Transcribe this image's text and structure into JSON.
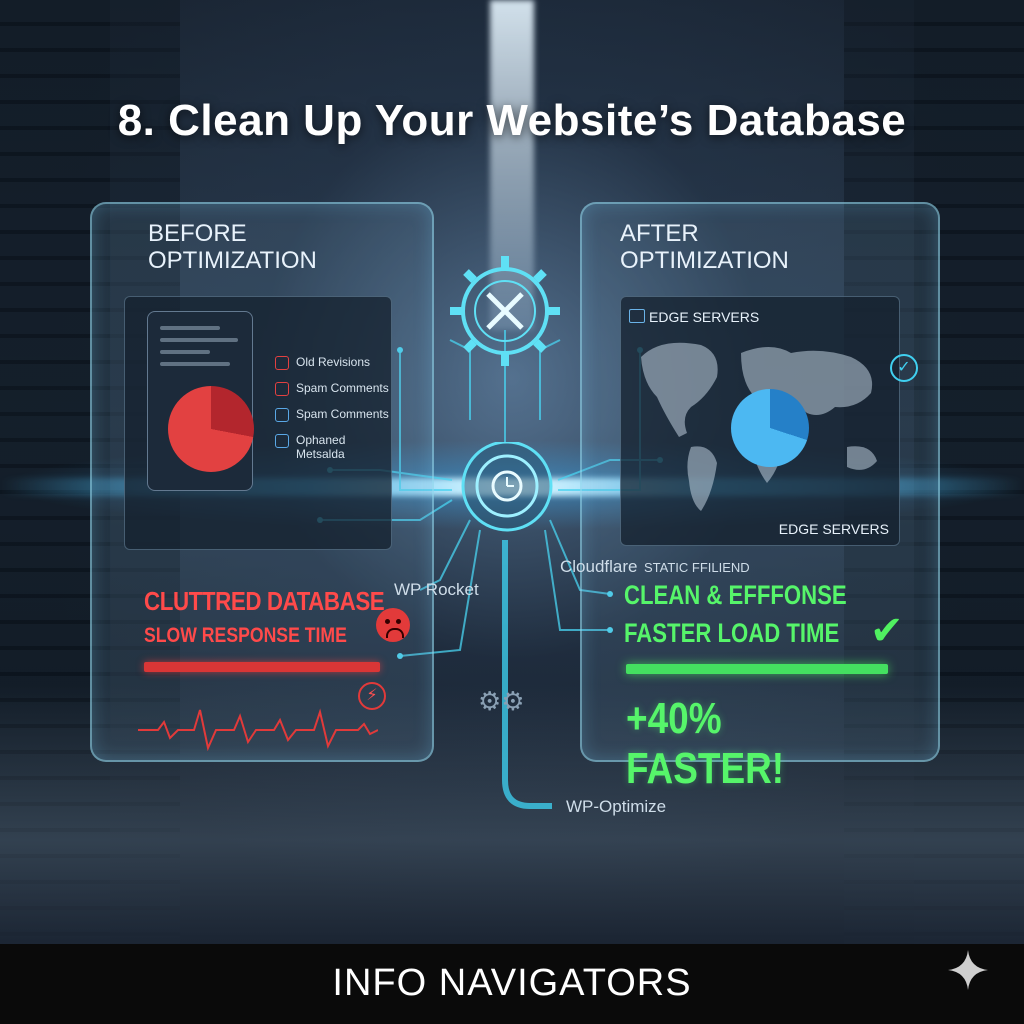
{
  "title": "8. Clean Up Your Website’s Database",
  "before": {
    "heading": "BEFORE\nOPTIMIZATION",
    "items": [
      {
        "label": "Old Revisions",
        "icon": "trash-icon"
      },
      {
        "label": "Spam Comments",
        "icon": "comment-icon"
      },
      {
        "label": "Spam Comments",
        "icon": "comment-icon"
      },
      {
        "label": "Ophaned\nMetsalda",
        "icon": "tag-icon"
      }
    ],
    "status_main": "CLUTTRED DATABASE",
    "status_sub": "SLOW RESPONSE TIME",
    "accent": "#e23a3a"
  },
  "after": {
    "heading": "AFTER\nOPTIMIZATION",
    "map_label_top": "EDGE SERVERS",
    "map_label_bottom": "EDGE SERVERS",
    "status_main": "CLEAN & EFFFONSE",
    "status_sub": "FASTER LOAD TIME",
    "improvement": "+40% FASTER!",
    "accent": "#56f56a"
  },
  "tools": {
    "wp_rocket": "WP Rocket",
    "cloudflare": "Cloudflare",
    "static": "STATIC FFILIEND",
    "wp_optimize": "WP-Optimize"
  },
  "footer": {
    "brand": "INFO NAVIGATORS"
  }
}
